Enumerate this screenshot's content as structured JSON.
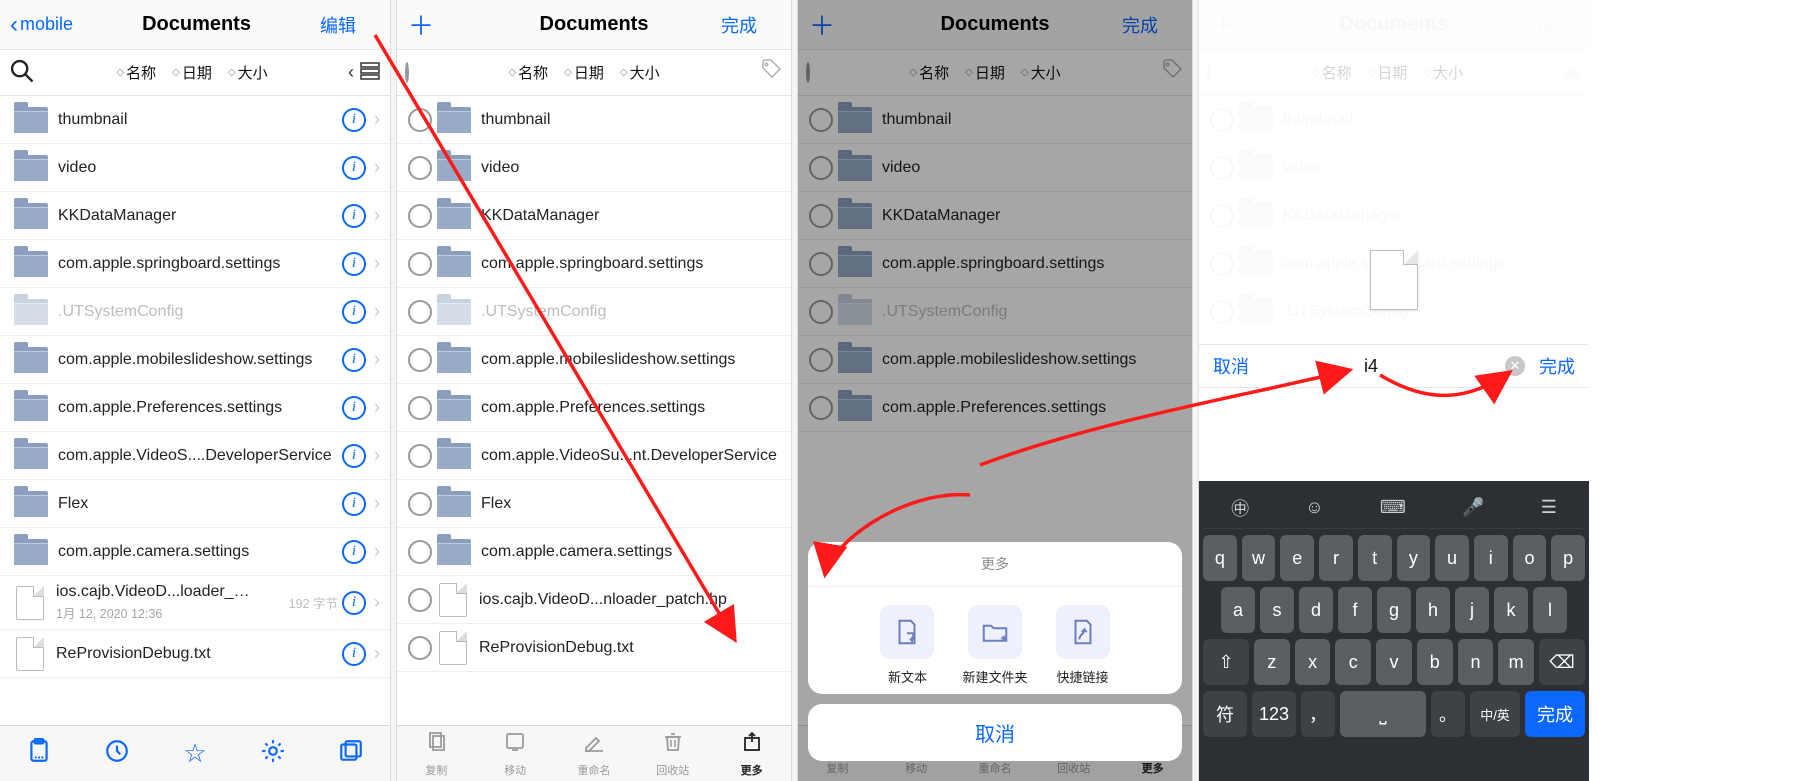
{
  "titles": {
    "documents": "Documents"
  },
  "p1": {
    "back": "mobile",
    "edit": "编辑",
    "sort": {
      "name": "名称",
      "date": "日期",
      "size": "大小"
    },
    "items": [
      {
        "name": "thumbnail"
      },
      {
        "name": "video"
      },
      {
        "name": "KKDataManager"
      },
      {
        "name": "com.apple.springboard.settings"
      },
      {
        "name": ".UTSystemConfig",
        "dim": true
      },
      {
        "name": "com.apple.mobileslideshow.settings"
      },
      {
        "name": "com.apple.Preferences.settings"
      },
      {
        "name": "com.apple.VideoS....DeveloperService"
      },
      {
        "name": "Flex"
      },
      {
        "name": "com.apple.camera.settings"
      },
      {
        "name": "ios.cajb.VideoD...loader_patch.hp",
        "sub": "1月 12, 2020 12:36",
        "bytes": "192 字节",
        "file": true
      },
      {
        "name": "ReProvisionDebug.txt",
        "file": true
      }
    ]
  },
  "p2": {
    "done": "完成",
    "sort": {
      "name": "名称",
      "date": "日期",
      "size": "大小"
    },
    "items": [
      {
        "name": "thumbnail"
      },
      {
        "name": "video"
      },
      {
        "name": "KKDataManager"
      },
      {
        "name": "com.apple.springboard.settings"
      },
      {
        "name": ".UTSystemConfig",
        "dim": true
      },
      {
        "name": "com.apple.mobileslideshow.settings"
      },
      {
        "name": "com.apple.Preferences.settings"
      },
      {
        "name": "com.apple.VideoSu...nt.DeveloperService"
      },
      {
        "name": "Flex"
      },
      {
        "name": "com.apple.camera.settings"
      },
      {
        "name": "ios.cajb.VideoD...nloader_patch.hp",
        "file": true
      },
      {
        "name": "ReProvisionDebug.txt",
        "file": true
      }
    ],
    "tabs": {
      "copy": "复制",
      "move": "移动",
      "rename": "重命名",
      "trash": "回收站",
      "more": "更多"
    }
  },
  "p3": {
    "done": "完成",
    "items": [
      {
        "name": "thumbnail"
      },
      {
        "name": "video"
      },
      {
        "name": "KKDataManager"
      },
      {
        "name": "com.apple.springboard.settings"
      },
      {
        "name": ".UTSystemConfig",
        "dim": true
      },
      {
        "name": "com.apple.mobileslideshow.settings"
      },
      {
        "name": "com.apple.Preferences.settings"
      }
    ],
    "sheet": {
      "title": "更多",
      "act1": "新文本",
      "act2": "新建文件夹",
      "act3": "快捷链接",
      "cancel": "取消"
    }
  },
  "p4": {
    "done": "完成",
    "items": [
      {
        "name": "thumbnail"
      },
      {
        "name": "video"
      },
      {
        "name": "KKDataManager"
      },
      {
        "name": "com.apple.springboard.settings"
      },
      {
        "name": ".UTSystemConfig"
      }
    ],
    "rename": {
      "cancel": "取消",
      "value": "i4",
      "done": "完成"
    },
    "keys": {
      "r2": [
        "q",
        "w",
        "e",
        "r",
        "t",
        "y",
        "u",
        "i",
        "o",
        "p"
      ],
      "r3": [
        "a",
        "s",
        "d",
        "f",
        "g",
        "h",
        "j",
        "k",
        "l"
      ],
      "r4": [
        "z",
        "x",
        "c",
        "v",
        "b",
        "n",
        "m"
      ],
      "fu": "符",
      "num": "123",
      "lang": "中/英",
      "go": "完成"
    }
  }
}
